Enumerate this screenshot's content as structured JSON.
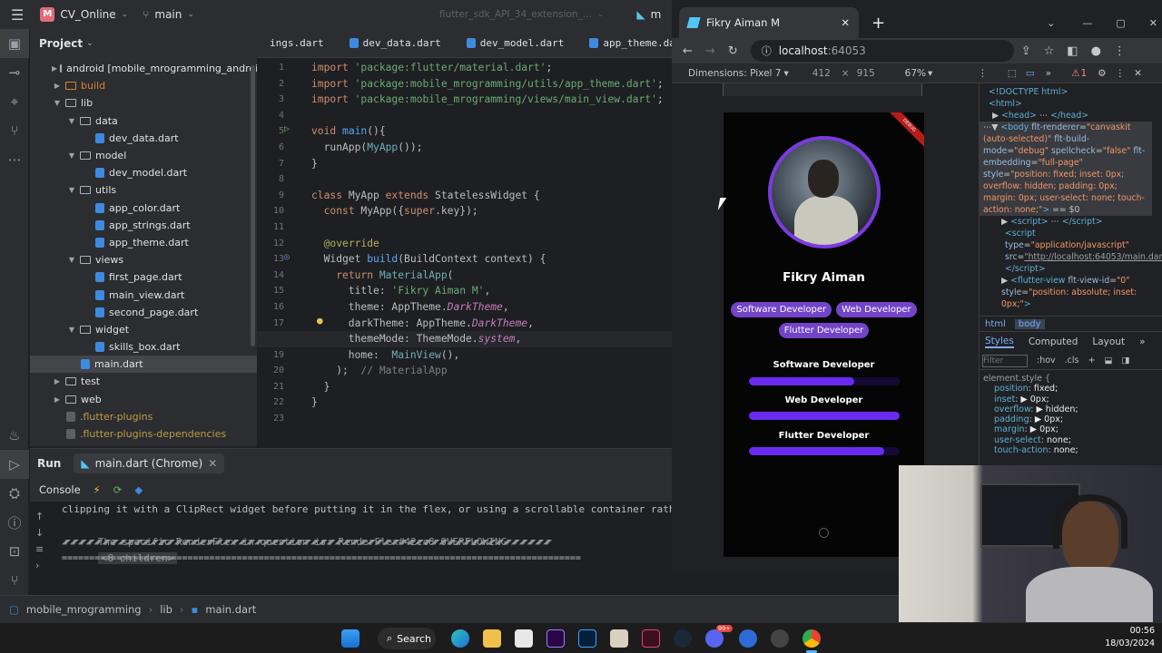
{
  "ide": {
    "project_name": "CV_Online",
    "project_badge": "M",
    "branch": "main",
    "run_config": "flutter_sdk_API_34_extension_...",
    "run_config_short": "m"
  },
  "project_panel": {
    "title": "Project",
    "tree": [
      {
        "label": "android [mobile_mrogramming_android]",
        "indent": 1,
        "arrow": "▶",
        "type": "folder"
      },
      {
        "label": "build",
        "indent": 1,
        "arrow": "▶",
        "type": "folder",
        "style": "orange"
      },
      {
        "label": "lib",
        "indent": 1,
        "arrow": "▼",
        "type": "folder"
      },
      {
        "label": "data",
        "indent": 2,
        "arrow": "▼",
        "type": "folder"
      },
      {
        "label": "dev_data.dart",
        "indent": 3,
        "arrow": "",
        "type": "file"
      },
      {
        "label": "model",
        "indent": 2,
        "arrow": "▼",
        "type": "folder"
      },
      {
        "label": "dev_model.dart",
        "indent": 3,
        "arrow": "",
        "type": "file"
      },
      {
        "label": "utils",
        "indent": 2,
        "arrow": "▼",
        "type": "folder"
      },
      {
        "label": "app_color.dart",
        "indent": 3,
        "arrow": "",
        "type": "file"
      },
      {
        "label": "app_strings.dart",
        "indent": 3,
        "arrow": "",
        "type": "file"
      },
      {
        "label": "app_theme.dart",
        "indent": 3,
        "arrow": "",
        "type": "file"
      },
      {
        "label": "views",
        "indent": 2,
        "arrow": "▼",
        "type": "folder"
      },
      {
        "label": "first_page.dart",
        "indent": 3,
        "arrow": "",
        "type": "file"
      },
      {
        "label": "main_view.dart",
        "indent": 3,
        "arrow": "",
        "type": "file"
      },
      {
        "label": "second_page.dart",
        "indent": 3,
        "arrow": "",
        "type": "file"
      },
      {
        "label": "widget",
        "indent": 2,
        "arrow": "▼",
        "type": "folder"
      },
      {
        "label": "skills_box.dart",
        "indent": 3,
        "arrow": "",
        "type": "file"
      },
      {
        "label": "main.dart",
        "indent": 2,
        "arrow": "",
        "type": "file",
        "selected": true
      },
      {
        "label": "test",
        "indent": 1,
        "arrow": "▶",
        "type": "folder"
      },
      {
        "label": "web",
        "indent": 1,
        "arrow": "▶",
        "type": "folder"
      },
      {
        "label": ".flutter-plugins",
        "indent": 1,
        "arrow": "",
        "type": "file",
        "style": "excluded"
      },
      {
        "label": ".flutter-plugins-dependencies",
        "indent": 1,
        "arrow": "",
        "type": "file",
        "style": "excluded"
      }
    ]
  },
  "editor": {
    "tabs": [
      "ings.dart",
      "dev_data.dart",
      "dev_model.dart",
      "app_theme.dart"
    ],
    "line_numbers": [
      "1",
      "2",
      "3",
      "4",
      "5",
      "6",
      "7",
      "8",
      "9",
      "10",
      "11",
      "12",
      "13",
      "14",
      "15",
      "16",
      "17",
      "18",
      "19",
      "20",
      "21",
      "22",
      "23"
    ]
  },
  "run_panel": {
    "run_label": "Run",
    "run_tab": "main.dart (Chrome)",
    "console_label": "Console",
    "lines": [
      "clipping it with a ClipRect widget before putting it in the flex, or using a scrollable container rather",
      "The specific RenderFlex in question is: RenderFlex#42cc8 OVERFLOWING",
      "◢◤◢◤◢◤◢◤◢◤◢◤◢◤◢◤◢◤◢◤◢◤◢◤◢◤◢◤◢◤◢◤◢◤◢◤◢◤◢◤◢◤◢◤◢◤◢◤◢◤◢◤◢◤◢◤◢◤◢◤◢◤◢◤◢◤◢◤◢◤◢◤◢◤◢◤◢◤◢◤◢◤◢◤◢◤◢◤◢◤◢◤◢◤◢◤◢◤◢◤◢◤◢◤◢◤◢◤◢◤◢◤◢◤◢◤◢◤◢◤◢◤",
      "==============================================================================================="
    ],
    "children_badge": "<8 children>"
  },
  "status_bar": {
    "crumbs": [
      "mobile_mrogramming",
      "lib",
      "main.dart"
    ]
  },
  "browser": {
    "tab_title": "Fikry Aiman M",
    "url_host": "localhost",
    "url_port": ":64053",
    "dimensions_label": "Dimensions: Pixel 7",
    "width": "412",
    "times": "×",
    "height": "915",
    "zoom": "67%",
    "issues_count": "1"
  },
  "app": {
    "name": "Fikry Aiman",
    "chips": [
      "Software Developer",
      "Web Developer",
      "Flutter Developer"
    ],
    "debug_label": "DEBUG",
    "skills": [
      {
        "label": "Software Developer",
        "level": 0.7
      },
      {
        "label": "Web Developer",
        "level": 1.0
      },
      {
        "label": "Flutter Developer",
        "level": 0.9
      }
    ]
  },
  "devtools": {
    "crumbs": [
      "html",
      "body"
    ],
    "style_tabs": [
      "Styles",
      "Computed",
      "Layout"
    ],
    "filter_placeholder": "Filter",
    "hov": ":hov",
    "cls": ".cls",
    "element_style": "element.style {",
    "rules": [
      {
        "prop": "position",
        "val": "fixed;"
      },
      {
        "prop": "inset",
        "val": "▶ 0px;"
      },
      {
        "prop": "overflow",
        "val": "▶ hidden;"
      },
      {
        "prop": "padding",
        "val": "▶ 0px;"
      },
      {
        "prop": "margin",
        "val": "▶ 0px;"
      },
      {
        "prop": "user-select",
        "val": "none;"
      },
      {
        "prop": "touch-action",
        "val": "none;"
      }
    ]
  },
  "taskbar": {
    "search_label": "Search",
    "time": "00:56",
    "date": "18/03/2024",
    "discord_badge": "99+"
  },
  "colors": {
    "accent": "#6a2bf0",
    "chip": "#7244c7",
    "ide_bg": "#1e1f22"
  }
}
